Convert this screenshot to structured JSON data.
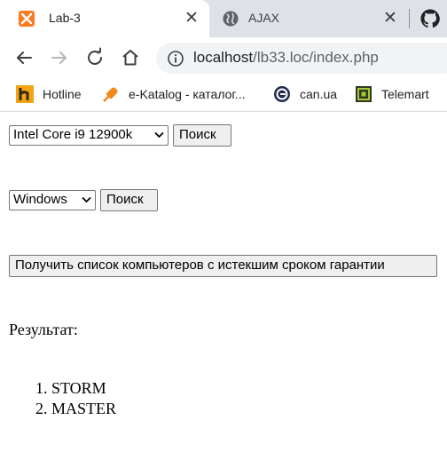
{
  "browser": {
    "tabs": [
      {
        "title": "Lab-3",
        "icon": "xampp-icon",
        "active": true
      },
      {
        "title": "AJAX",
        "icon": "globe-icon",
        "active": false
      }
    ],
    "url_host": "localhost",
    "url_path": "/lb33.loc/index.php",
    "bookmarks": [
      {
        "label": "Hotline",
        "icon": "hotline-icon"
      },
      {
        "label": "e-Katalog - каталог...",
        "icon": "ekatalog-icon"
      },
      {
        "label": "can.ua",
        "icon": "canua-icon"
      },
      {
        "label": "Telemart",
        "icon": "telemart-icon"
      }
    ]
  },
  "page": {
    "cpu_select": {
      "value": "Intel Core i9 12900k"
    },
    "cpu_search_label": "Поиск",
    "os_select": {
      "value": "Windows"
    },
    "os_search_label": "Поиск",
    "warranty_button_label": "Получить список компьютеров с истекшим сроком гарантии",
    "result_label": "Результат:",
    "results": [
      "STORM",
      "MASTER"
    ]
  },
  "colors": {
    "tabstrip": "#dee1e6",
    "omnibox": "#f1f3f4",
    "button_bg": "#efefef",
    "border": "#767676"
  }
}
